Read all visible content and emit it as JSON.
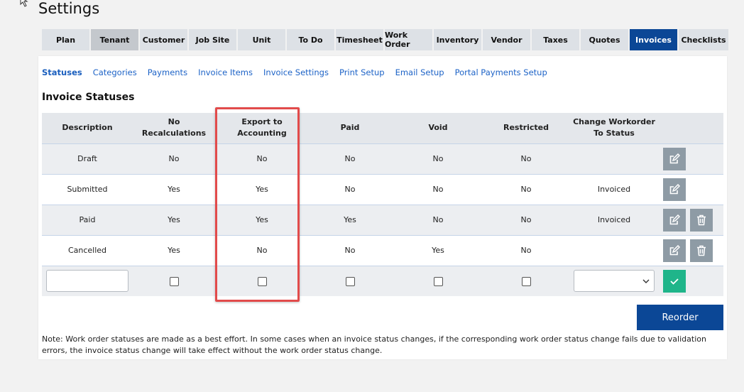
{
  "page": {
    "title": "Settings"
  },
  "tabs": [
    {
      "label": "Plan",
      "state": "normal"
    },
    {
      "label": "Tenant",
      "state": "hover"
    },
    {
      "label": "Customer",
      "state": "normal"
    },
    {
      "label": "Job Site",
      "state": "normal"
    },
    {
      "label": "Unit",
      "state": "normal"
    },
    {
      "label": "To Do",
      "state": "normal"
    },
    {
      "label": "Timesheet",
      "state": "normal"
    },
    {
      "label": "Work Order",
      "state": "normal"
    },
    {
      "label": "Inventory",
      "state": "normal"
    },
    {
      "label": "Vendor",
      "state": "normal"
    },
    {
      "label": "Taxes",
      "state": "normal"
    },
    {
      "label": "Quotes",
      "state": "normal"
    },
    {
      "label": "Invoices",
      "state": "active"
    },
    {
      "label": "Checklists",
      "state": "normal"
    }
  ],
  "subnav": [
    {
      "label": "Statuses",
      "current": true
    },
    {
      "label": "Categories",
      "current": false
    },
    {
      "label": "Payments",
      "current": false
    },
    {
      "label": "Invoice Items",
      "current": false
    },
    {
      "label": "Invoice Settings",
      "current": false
    },
    {
      "label": "Print Setup",
      "current": false
    },
    {
      "label": "Email Setup",
      "current": false
    },
    {
      "label": "Portal Payments Setup",
      "current": false
    }
  ],
  "section": {
    "title": "Invoice Statuses"
  },
  "table": {
    "headers": {
      "description": "Description",
      "no_recalc": "No Recalculations",
      "export_line1": "Export to",
      "export_line2": "Accounting",
      "paid": "Paid",
      "void": "Void",
      "restricted": "Restricted",
      "change_line1": "Change Workorder",
      "change_line2": "To Status"
    },
    "rows": [
      {
        "description": "Draft",
        "no_recalc": "No",
        "export": "No",
        "paid": "No",
        "void": "No",
        "restricted": "No",
        "change": ""
      },
      {
        "description": "Submitted",
        "no_recalc": "Yes",
        "export": "Yes",
        "paid": "No",
        "void": "No",
        "restricted": "No",
        "change": "Invoiced"
      },
      {
        "description": "Paid",
        "no_recalc": "Yes",
        "export": "Yes",
        "paid": "Yes",
        "void": "No",
        "restricted": "No",
        "change": "Invoiced"
      },
      {
        "description": "Cancelled",
        "no_recalc": "Yes",
        "export": "No",
        "paid": "No",
        "void": "Yes",
        "restricted": "No",
        "change": ""
      }
    ],
    "new_row": {
      "description_value": "",
      "select_value": ""
    }
  },
  "buttons": {
    "reorder": "Reorder"
  },
  "note": "Note: Work order statuses are made as a best effort. In some cases when an invoice status changes, if the corresponding work order status change fails due to validation errors, the invoice status change will take effect without the work order status change.",
  "icons": {
    "edit": "edit-icon",
    "delete": "trash-icon",
    "confirm": "check-icon",
    "dropdown": "chevron-down-icon"
  },
  "colors": {
    "accent": "#0b4796",
    "link": "#1d63c7",
    "action_button": "#8e9ba5",
    "confirm_button": "#1fb58a",
    "highlight_box": "#e24b4b"
  }
}
